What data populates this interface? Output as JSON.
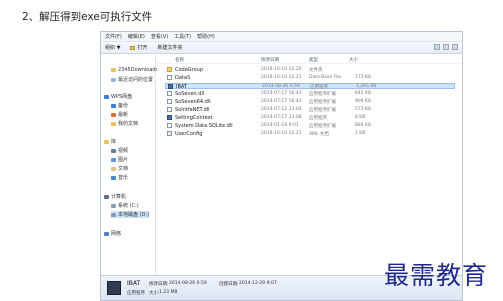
{
  "heading": "2、解压得到exe可执行文件",
  "menubar": [
    "文件(F)",
    "编辑(E)",
    "查看(V)",
    "工具(T)",
    "帮助(H)"
  ],
  "toolbar": {
    "organize": "组织 ▼",
    "open": "打开",
    "new_folder": "新建文件夹"
  },
  "nav": [
    {
      "label": "2345Downloads",
      "icon": "folder-icon",
      "color": "#e8c25a"
    },
    {
      "label": "最近访问的位置",
      "icon": "recent-icon",
      "color": "#9fb3d1"
    },
    {
      "label": "WPS网盘",
      "icon": "cloud-icon",
      "color": "#3d7dd8"
    },
    {
      "label": "备份",
      "icon": "backup-icon",
      "color": "#3d7dd8"
    },
    {
      "label": "最新",
      "icon": "new-icon",
      "color": "#e46b38"
    },
    {
      "label": "我的文档",
      "icon": "documents-icon",
      "color": "#e8c25a"
    },
    {
      "label": "库",
      "icon": "library-icon",
      "color": "#e8c25a"
    },
    {
      "label": "视频",
      "icon": "video-icon",
      "color": "#6d7d96"
    },
    {
      "label": "图片",
      "icon": "pictures-icon",
      "color": "#5c9bd1"
    },
    {
      "label": "文档",
      "icon": "doc-icon",
      "color": "#d7c48c"
    },
    {
      "label": "音乐",
      "icon": "music-icon",
      "color": "#4c87c7"
    },
    {
      "label": "计算机",
      "icon": "computer-icon",
      "color": "#5d6f8c"
    },
    {
      "label": "系统 (C:)",
      "icon": "drive-icon",
      "color": "#8b9bb3"
    },
    {
      "label": "本地磁盘 (D:)",
      "icon": "drive-icon",
      "color": "#8b9bb3"
    },
    {
      "label": "网络",
      "icon": "network-icon",
      "color": "#4e84c4"
    }
  ],
  "columns": {
    "name": "名称",
    "date": "修改日期",
    "type": "类型",
    "size": "大小"
  },
  "files": [
    {
      "name": "CodeGroup",
      "date": "2019-10-10 11:20",
      "type": "文件夹",
      "size": "",
      "icon": "folder"
    },
    {
      "name": "DataS",
      "date": "2019-10-10 11:21",
      "type": "Data Base File",
      "size": "173 KB",
      "icon": "file"
    },
    {
      "name": "IBAT",
      "date": "2014-08-26 0:59",
      "type": "应用程序",
      "size": "1,265 KB",
      "icon": "exe"
    },
    {
      "name": "SoSeven.dll",
      "date": "2014-07-17 16:43",
      "type": "应用程序扩展",
      "size": "842 KB",
      "icon": "file"
    },
    {
      "name": "SoSeven64.dll",
      "date": "2014-07-17 16:43",
      "type": "应用程序扩展",
      "size": "904 KB",
      "icon": "file"
    },
    {
      "name": "SoIntfaNET.dll",
      "date": "2014-07-12 13:04",
      "type": "应用程序扩展",
      "size": "573 KB",
      "icon": "file"
    },
    {
      "name": "SettingContext",
      "date": "2014-07-17 13:08",
      "type": "应用程序",
      "size": "8 KB",
      "icon": "exe"
    },
    {
      "name": "System.Data.SQLite.dll",
      "date": "2014-01-18 9:01",
      "type": "应用程序扩展",
      "size": "884 KB",
      "icon": "file"
    },
    {
      "name": "UserConfig",
      "date": "2019-10-10 11:21",
      "type": "XML 文档",
      "size": "1 KB",
      "icon": "cfg"
    }
  ],
  "details": {
    "name": "IBAT",
    "kind": "应用程序",
    "modified_label": "修改日期:",
    "modified": "2014-08-26 0:59",
    "created_label": "创建日期:",
    "created": "2014-12-29 9:07",
    "size_label": "大小:",
    "size": "1.23 MB"
  },
  "watermark": "最需教育",
  "colors": {
    "selection": "#cfe3f8",
    "window_border": "#b9c4d3",
    "watermark": "#1f2a8a"
  }
}
